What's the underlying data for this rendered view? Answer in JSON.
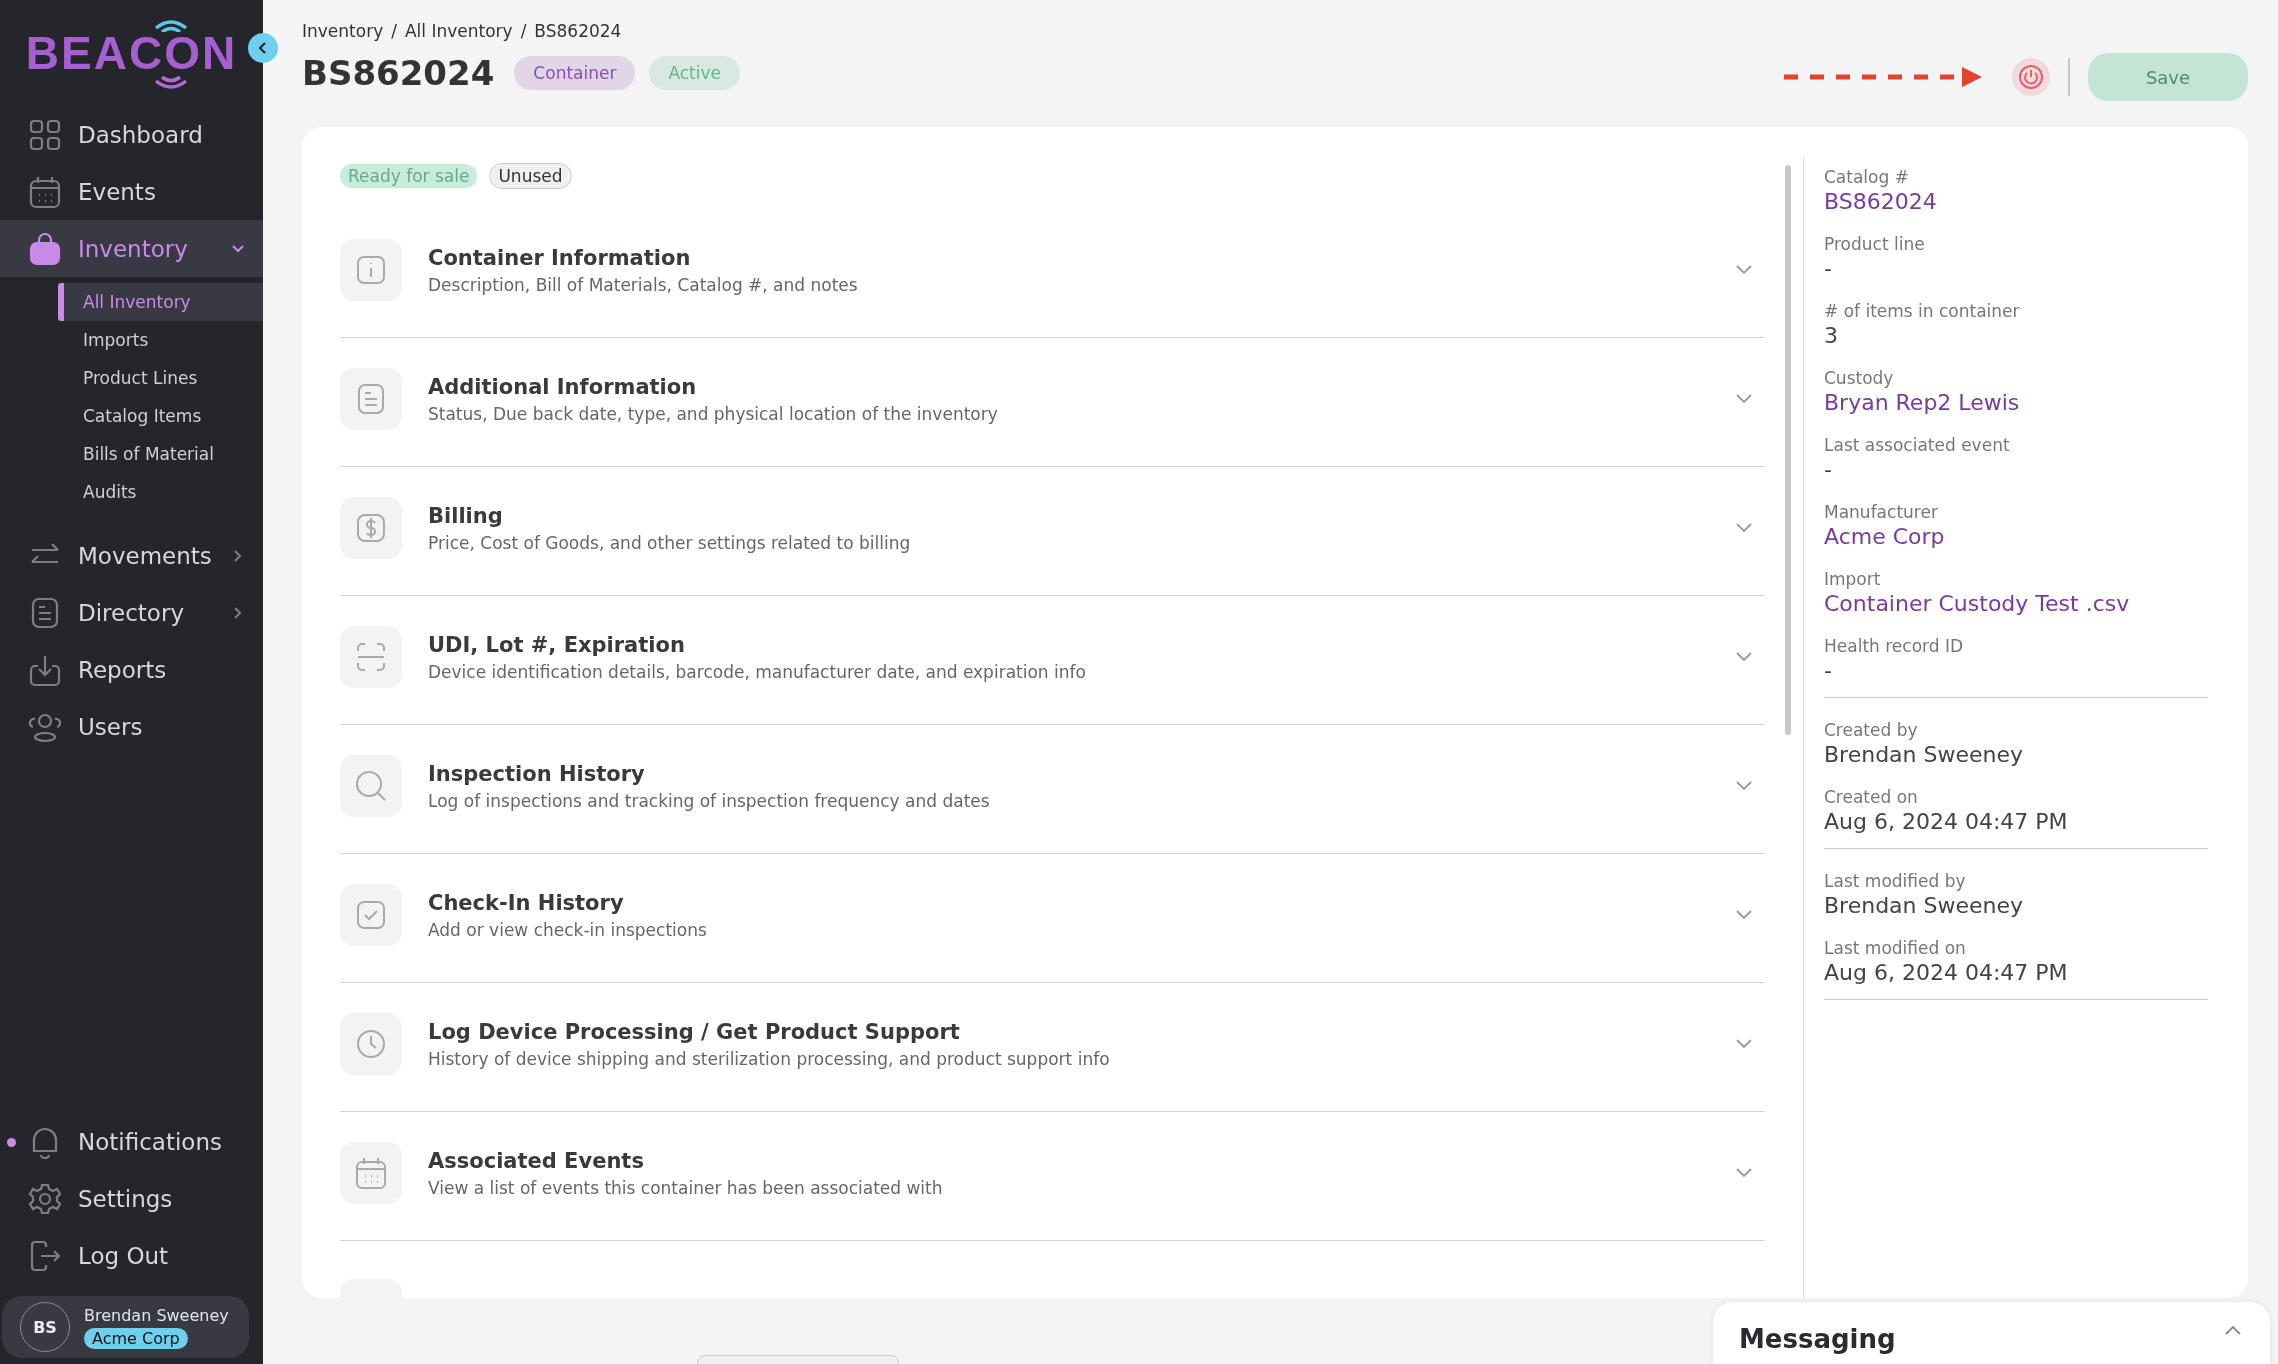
{
  "sidebar": {
    "logo": "BEACON",
    "nav": [
      {
        "label": "Dashboard",
        "selected": false
      },
      {
        "label": "Events",
        "selected": false
      },
      {
        "label": "Inventory",
        "selected": true,
        "expanded": true,
        "children": [
          {
            "label": "All Inventory",
            "selected": true
          },
          {
            "label": "Imports",
            "selected": false
          },
          {
            "label": "Product Lines",
            "selected": false
          },
          {
            "label": "Catalog Items",
            "selected": false
          },
          {
            "label": "Bills of Material",
            "selected": false
          },
          {
            "label": "Audits",
            "selected": false
          }
        ]
      },
      {
        "label": "Movements",
        "selected": false,
        "expanded": false
      },
      {
        "label": "Directory",
        "selected": false,
        "expanded": false
      },
      {
        "label": "Reports",
        "selected": false
      },
      {
        "label": "Users",
        "selected": false
      }
    ],
    "footer_nav": [
      {
        "label": "Notifications",
        "unread": true
      },
      {
        "label": "Settings",
        "unread": false
      },
      {
        "label": "Log Out",
        "unread": false
      }
    ],
    "user": {
      "initials": "BS",
      "name": "Brendan Sweeney",
      "organization": "Acme Corp"
    }
  },
  "breadcrumbs": {
    "separator": "/",
    "items": [
      "Inventory",
      "All Inventory",
      "BS862024"
    ]
  },
  "title": "BS862024",
  "badges": [
    {
      "label": "Container",
      "color": "#8b4fb3"
    },
    {
      "label": "Active",
      "color": "#5cb98c"
    }
  ],
  "save_button": {
    "label": "Save",
    "disabled": true
  },
  "status_tags": [
    {
      "label": "Ready for sale",
      "kind": "success"
    },
    {
      "label": "Unused",
      "kind": "neutral"
    }
  ],
  "sections": [
    {
      "title": "Container Information",
      "description": "Description, Bill of Materials, Catalog #, and notes"
    },
    {
      "title": "Additional Information",
      "description": "Status, Due back date, type, and physical location of the inventory"
    },
    {
      "title": "Billing",
      "description": "Price, Cost of Goods, and other settings related to billing"
    },
    {
      "title": "UDI, Lot #, Expiration",
      "description": "Device identification details, barcode, manufacturer date, and expiration info"
    },
    {
      "title": "Inspection History",
      "description": "Log of inspections and tracking of inspection frequency and dates"
    },
    {
      "title": "Check-In History",
      "description": "Add or view check-in inspections"
    },
    {
      "title": "Log Device Processing / Get Product Support",
      "description": "History of device shipping and sterilization processing, and product support info"
    },
    {
      "title": "Associated Events",
      "description": "View a list of events this container has been associated with"
    }
  ],
  "details": [
    {
      "fields": [
        {
          "label": "Catalog #",
          "value": "BS862024",
          "kind": "link"
        },
        {
          "label": "Product line",
          "value": "-",
          "kind": "text"
        },
        {
          "label": "# of items in container",
          "value": "3",
          "kind": "text"
        },
        {
          "label": "Custody",
          "value": "Bryan Rep2 Lewis",
          "kind": "link"
        },
        {
          "label": "Last associated event",
          "value": "-",
          "kind": "text"
        },
        {
          "label": "Manufacturer",
          "value": "Acme Corp",
          "kind": "link"
        },
        {
          "label": "Import",
          "value": "Container Custody Test .csv",
          "kind": "link"
        },
        {
          "label": "Health record ID",
          "value": "-",
          "kind": "text"
        }
      ]
    },
    {
      "fields": [
        {
          "label": "Created by",
          "value": "Brendan Sweeney",
          "kind": "text"
        },
        {
          "label": "Created on",
          "value": "Aug 6, 2024 04:47 PM",
          "kind": "text"
        }
      ]
    },
    {
      "fields": [
        {
          "label": "Last modified by",
          "value": "Brendan Sweeney",
          "kind": "text"
        },
        {
          "label": "Last modified on",
          "value": "Aug 6, 2024 04:47 PM",
          "kind": "text"
        }
      ]
    }
  ],
  "messaging": {
    "title": "Messaging"
  }
}
